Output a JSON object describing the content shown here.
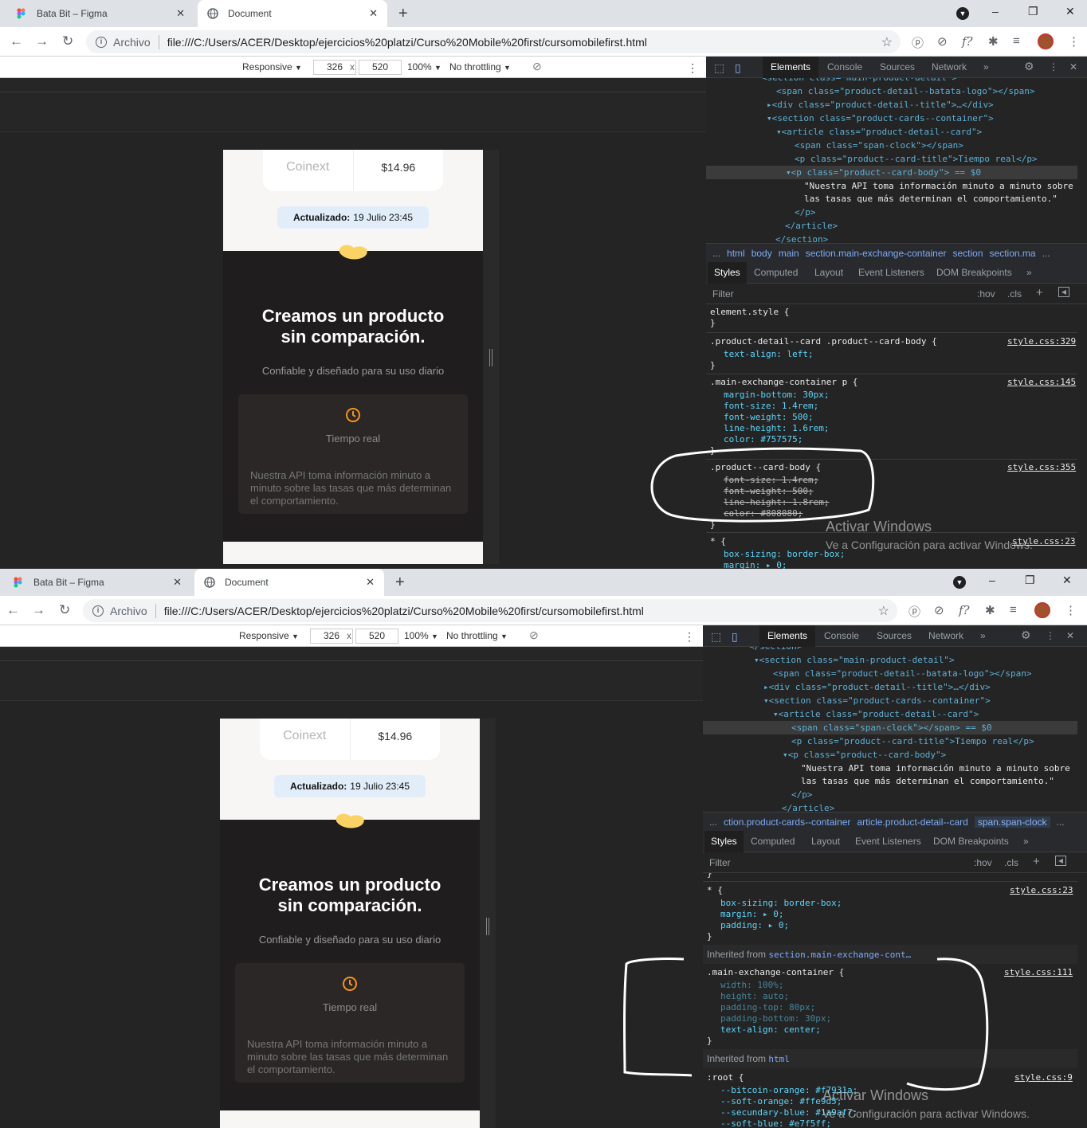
{
  "browser": {
    "tabs": [
      {
        "label": "Bata Bit – Figma",
        "active": false
      },
      {
        "label": "Document",
        "active": true
      }
    ],
    "new_tab": "+",
    "window_controls": [
      "–",
      "❐",
      "✕"
    ],
    "address": {
      "protocol": "Archivo",
      "url": "file:///C:/Users/ACER/Desktop/ejercicios%20platzi/Curso%20Mobile%20first/cursomobilefirst.html"
    },
    "extensions": [
      "pinterest-icon",
      "block-icon",
      "formula-icon",
      "puzzle-icon",
      "playlist-icon"
    ],
    "ext_glyphs": [
      "ⓟ",
      "⊘",
      "f?",
      "✱",
      "≡"
    ]
  },
  "device_toolbar": {
    "mode": "Responsive",
    "width": "326",
    "times": "x",
    "height": "520",
    "zoom": "100%",
    "throttle": "No throttling",
    "dropdown": "▼"
  },
  "page": {
    "exchange_name": "Coinext",
    "exchange_price": "$14.96",
    "updated_label": "Actualizado:",
    "updated_value": "19 Julio 23:45",
    "heading_line1": "Creamos un producto",
    "heading_line2": "sin comparación.",
    "subtitle": "Confiable y diseñado para su uso diario",
    "card_title": "Tiempo real",
    "card_body": "Nuestra API toma información minuto a minuto sobre las tasas que más determinan el comportamiento."
  },
  "devtools": {
    "tabs": [
      "Elements",
      "Console",
      "Sources",
      "Network",
      "»"
    ],
    "style_tabs": [
      "Styles",
      "Computed",
      "Layout",
      "Event Listeners",
      "DOM Breakpoints",
      "»"
    ],
    "filter_placeholder": "Filter",
    "hov": ":hov",
    "cls": ".cls",
    "dom_top": [
      "<section class=\"main-product-detail\">",
      "<span class=\"product-detail--batata-logo\"></span>",
      "<div class=\"product-detail--title\">…</div>",
      "<section class=\"product-cards--container\">",
      "<article class=\"product-detail--card\">",
      "<span class=\"span-clock\"></span>",
      "<p class=\"product--card-title\">Tiempo real</p>",
      "<p class=\"product--card-body\"> == $0",
      "\"Nuestra API toma información minuto a minuto sobre",
      "las tasas que más determinan el comportamiento.\"",
      "</p>",
      "</article>",
      "</section>"
    ],
    "dom_bottom": [
      "</section>",
      "<section class=\"main-product-detail\">",
      "<span class=\"product-detail--batata-logo\"></span>",
      "<div class=\"product-detail--title\">…</div>",
      "<section class=\"product-cards--container\">",
      "<article class=\"product-detail--card\">",
      "<span class=\"span-clock\"></span> == $0",
      "<p class=\"product--card-title\">Tiempo real</p>",
      "<p class=\"product--card-body\">",
      "\"Nuestra API toma información minuto a minuto sobre",
      "las tasas que más determinan el comportamiento.\"",
      "</p>",
      "</article>"
    ],
    "crumbs_top": [
      "...",
      "html",
      "body",
      "main",
      "section.main-exchange-container",
      "section",
      "section.ma",
      "..."
    ],
    "crumbs_bottom": [
      "...",
      "ction.product-cards--container",
      "article.product-detail--card",
      "span.span-clock",
      "..."
    ],
    "rules_top": {
      "element_style": "element.style {",
      "close": "}",
      "r1_sel": ".product-detail--card .product--card-body {",
      "r1_src": "style.css:329",
      "r1_p1": "text-align: left;",
      "r2_sel": ".main-exchange-container p {",
      "r2_src": "style.css:145",
      "r2_p1": "margin-bottom: 30px;",
      "r2_p2": "font-size: 1.4rem;",
      "r2_p3": "font-weight: 500;",
      "r2_p4": "line-height: 1.6rem;",
      "r2_p5": "color: #757575;",
      "r3_sel": ".product--card-body {",
      "r3_src": "style.css:355",
      "r3_p1": "font-size: 1.4rem;",
      "r3_p2": "font-weight: 500;",
      "r3_p3": "line-height: 1.8rem;",
      "r3_p4": "color: #808080;",
      "r4_sel": "* {",
      "r4_src": "style.css:23",
      "r4_p1": "box-sizing: border-box;",
      "r4_p2": "margin: ▸ 0;"
    },
    "rules_bottom": {
      "close": "}",
      "r1_sel": "* {",
      "r1_src": "style.css:23",
      "r1_p1": "box-sizing: border-box;",
      "r1_p2": "margin: ▸ 0;",
      "r1_p3": "padding: ▸ 0;",
      "inh1_label": "Inherited from",
      "inh1_link": "section.main-exchange-cont…",
      "r2_sel": ".main-exchange-container {",
      "r2_src": "style.css:111",
      "r2_p1": "width: 100%;",
      "r2_p2": "height: auto;",
      "r2_p3": "padding-top: 80px;",
      "r2_p4": "padding-bottom: 30px;",
      "r2_p5": "text-align: center;",
      "inh2_label": "Inherited from",
      "inh2_link": "html",
      "r3_sel": ":root {",
      "r3_src": "style.css:9",
      "r3_p1": "--bitcoin-orange: #f7931a;",
      "r3_p2": "--soft-orange: #ffe9d5;",
      "r3_p3": "--secundary-blue: #1a9af7;",
      "r3_p4": "--soft-blue: #e7f5ff;"
    },
    "watermark_title": "Activar Windows",
    "watermark_sub": "Ve a Configuración para activar Windows."
  },
  "colors": {
    "accent_orange": "#f7931a",
    "chip_yellow": "#fbd364",
    "tag_blue": "#5db0d7"
  }
}
